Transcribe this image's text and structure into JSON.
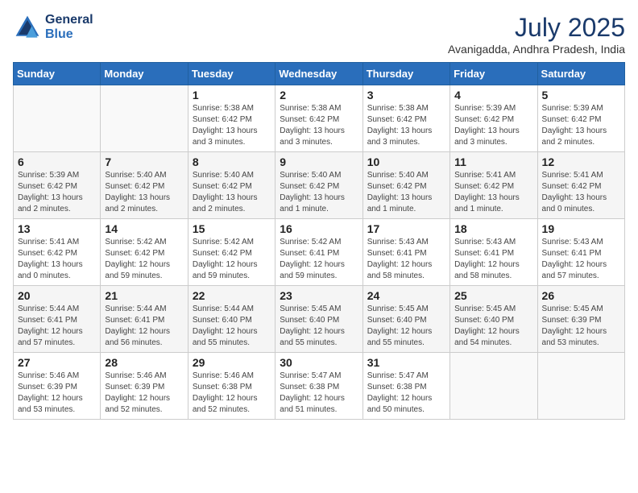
{
  "header": {
    "logo_line1": "General",
    "logo_line2": "Blue",
    "month_year": "July 2025",
    "location": "Avanigadda, Andhra Pradesh, India"
  },
  "weekdays": [
    "Sunday",
    "Monday",
    "Tuesday",
    "Wednesday",
    "Thursday",
    "Friday",
    "Saturday"
  ],
  "weeks": [
    [
      {
        "day": "",
        "info": ""
      },
      {
        "day": "",
        "info": ""
      },
      {
        "day": "1",
        "info": "Sunrise: 5:38 AM\nSunset: 6:42 PM\nDaylight: 13 hours and 3 minutes."
      },
      {
        "day": "2",
        "info": "Sunrise: 5:38 AM\nSunset: 6:42 PM\nDaylight: 13 hours and 3 minutes."
      },
      {
        "day": "3",
        "info": "Sunrise: 5:38 AM\nSunset: 6:42 PM\nDaylight: 13 hours and 3 minutes."
      },
      {
        "day": "4",
        "info": "Sunrise: 5:39 AM\nSunset: 6:42 PM\nDaylight: 13 hours and 3 minutes."
      },
      {
        "day": "5",
        "info": "Sunrise: 5:39 AM\nSunset: 6:42 PM\nDaylight: 13 hours and 2 minutes."
      }
    ],
    [
      {
        "day": "6",
        "info": "Sunrise: 5:39 AM\nSunset: 6:42 PM\nDaylight: 13 hours and 2 minutes."
      },
      {
        "day": "7",
        "info": "Sunrise: 5:40 AM\nSunset: 6:42 PM\nDaylight: 13 hours and 2 minutes."
      },
      {
        "day": "8",
        "info": "Sunrise: 5:40 AM\nSunset: 6:42 PM\nDaylight: 13 hours and 2 minutes."
      },
      {
        "day": "9",
        "info": "Sunrise: 5:40 AM\nSunset: 6:42 PM\nDaylight: 13 hours and 1 minute."
      },
      {
        "day": "10",
        "info": "Sunrise: 5:40 AM\nSunset: 6:42 PM\nDaylight: 13 hours and 1 minute."
      },
      {
        "day": "11",
        "info": "Sunrise: 5:41 AM\nSunset: 6:42 PM\nDaylight: 13 hours and 1 minute."
      },
      {
        "day": "12",
        "info": "Sunrise: 5:41 AM\nSunset: 6:42 PM\nDaylight: 13 hours and 0 minutes."
      }
    ],
    [
      {
        "day": "13",
        "info": "Sunrise: 5:41 AM\nSunset: 6:42 PM\nDaylight: 13 hours and 0 minutes."
      },
      {
        "day": "14",
        "info": "Sunrise: 5:42 AM\nSunset: 6:42 PM\nDaylight: 12 hours and 59 minutes."
      },
      {
        "day": "15",
        "info": "Sunrise: 5:42 AM\nSunset: 6:42 PM\nDaylight: 12 hours and 59 minutes."
      },
      {
        "day": "16",
        "info": "Sunrise: 5:42 AM\nSunset: 6:41 PM\nDaylight: 12 hours and 59 minutes."
      },
      {
        "day": "17",
        "info": "Sunrise: 5:43 AM\nSunset: 6:41 PM\nDaylight: 12 hours and 58 minutes."
      },
      {
        "day": "18",
        "info": "Sunrise: 5:43 AM\nSunset: 6:41 PM\nDaylight: 12 hours and 58 minutes."
      },
      {
        "day": "19",
        "info": "Sunrise: 5:43 AM\nSunset: 6:41 PM\nDaylight: 12 hours and 57 minutes."
      }
    ],
    [
      {
        "day": "20",
        "info": "Sunrise: 5:44 AM\nSunset: 6:41 PM\nDaylight: 12 hours and 57 minutes."
      },
      {
        "day": "21",
        "info": "Sunrise: 5:44 AM\nSunset: 6:41 PM\nDaylight: 12 hours and 56 minutes."
      },
      {
        "day": "22",
        "info": "Sunrise: 5:44 AM\nSunset: 6:40 PM\nDaylight: 12 hours and 55 minutes."
      },
      {
        "day": "23",
        "info": "Sunrise: 5:45 AM\nSunset: 6:40 PM\nDaylight: 12 hours and 55 minutes."
      },
      {
        "day": "24",
        "info": "Sunrise: 5:45 AM\nSunset: 6:40 PM\nDaylight: 12 hours and 55 minutes."
      },
      {
        "day": "25",
        "info": "Sunrise: 5:45 AM\nSunset: 6:40 PM\nDaylight: 12 hours and 54 minutes."
      },
      {
        "day": "26",
        "info": "Sunrise: 5:45 AM\nSunset: 6:39 PM\nDaylight: 12 hours and 53 minutes."
      }
    ],
    [
      {
        "day": "27",
        "info": "Sunrise: 5:46 AM\nSunset: 6:39 PM\nDaylight: 12 hours and 53 minutes."
      },
      {
        "day": "28",
        "info": "Sunrise: 5:46 AM\nSunset: 6:39 PM\nDaylight: 12 hours and 52 minutes."
      },
      {
        "day": "29",
        "info": "Sunrise: 5:46 AM\nSunset: 6:38 PM\nDaylight: 12 hours and 52 minutes."
      },
      {
        "day": "30",
        "info": "Sunrise: 5:47 AM\nSunset: 6:38 PM\nDaylight: 12 hours and 51 minutes."
      },
      {
        "day": "31",
        "info": "Sunrise: 5:47 AM\nSunset: 6:38 PM\nDaylight: 12 hours and 50 minutes."
      },
      {
        "day": "",
        "info": ""
      },
      {
        "day": "",
        "info": ""
      }
    ]
  ]
}
